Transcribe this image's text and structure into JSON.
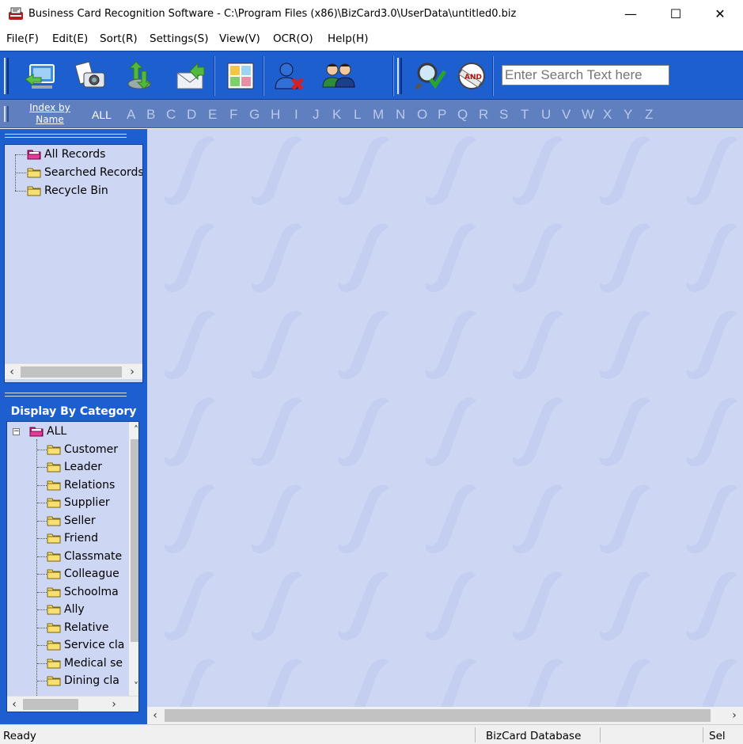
{
  "window": {
    "title": "Business Card Recognition Software - C:\\Program Files (x86)\\BizCard3.0\\UserData\\untitled0.biz",
    "minimize": "—",
    "maximize": "☐",
    "close": "✕"
  },
  "menu": [
    {
      "label": "File(F)"
    },
    {
      "label": "Edit(E)"
    },
    {
      "label": "Sort(R)"
    },
    {
      "label": "Settings(S)"
    },
    {
      "label": "View(V)"
    },
    {
      "label": "OCR(O)"
    },
    {
      "label": "Help(H)"
    }
  ],
  "toolbar": {
    "buttons": [
      {
        "icon": "scan-card-icon"
      },
      {
        "icon": "camera-capture-icon"
      },
      {
        "icon": "import-export-icon"
      },
      {
        "icon": "email-send-icon"
      },
      {
        "icon": "card-view-icon"
      },
      {
        "icon": "delete-contact-icon"
      },
      {
        "icon": "contacts-group-icon"
      },
      {
        "icon": "search-icon"
      },
      {
        "icon": "and-search-icon"
      }
    ],
    "search_placeholder": "Enter Search Text here"
  },
  "alphabet_bar": {
    "index_by_line1": "Index by",
    "index_by_line2": "Name",
    "all": "ALL",
    "letters": [
      "A",
      "B",
      "C",
      "D",
      "E",
      "F",
      "G",
      "H",
      "I",
      "J",
      "K",
      "L",
      "M",
      "N",
      "O",
      "P",
      "Q",
      "R",
      "S",
      "T",
      "U",
      "V",
      "W",
      "X",
      "Y",
      "Z"
    ]
  },
  "records_tree": {
    "items": [
      {
        "label": "All Records"
      },
      {
        "label": "Searched Records"
      },
      {
        "label": "Recycle Bin"
      }
    ]
  },
  "category_panel": {
    "title": "Display By Category",
    "root": "ALL",
    "items": [
      {
        "label": "Customer"
      },
      {
        "label": "Leader"
      },
      {
        "label": "Relations"
      },
      {
        "label": "Supplier"
      },
      {
        "label": "Seller"
      },
      {
        "label": "Friend"
      },
      {
        "label": "Classmate"
      },
      {
        "label": "Colleague"
      },
      {
        "label": "Schoolma"
      },
      {
        "label": "Ally"
      },
      {
        "label": "Relative"
      },
      {
        "label": "Service cla"
      },
      {
        "label": "Medical se"
      },
      {
        "label": "Dining cla"
      }
    ]
  },
  "status": {
    "left": "Ready",
    "middle": "BizCard Database",
    "right": "Sel"
  },
  "colors": {
    "toolbar_blue": "#1e5fcf",
    "panel_bg": "#cdd7f3",
    "alphabar": "#5f7fbe"
  }
}
